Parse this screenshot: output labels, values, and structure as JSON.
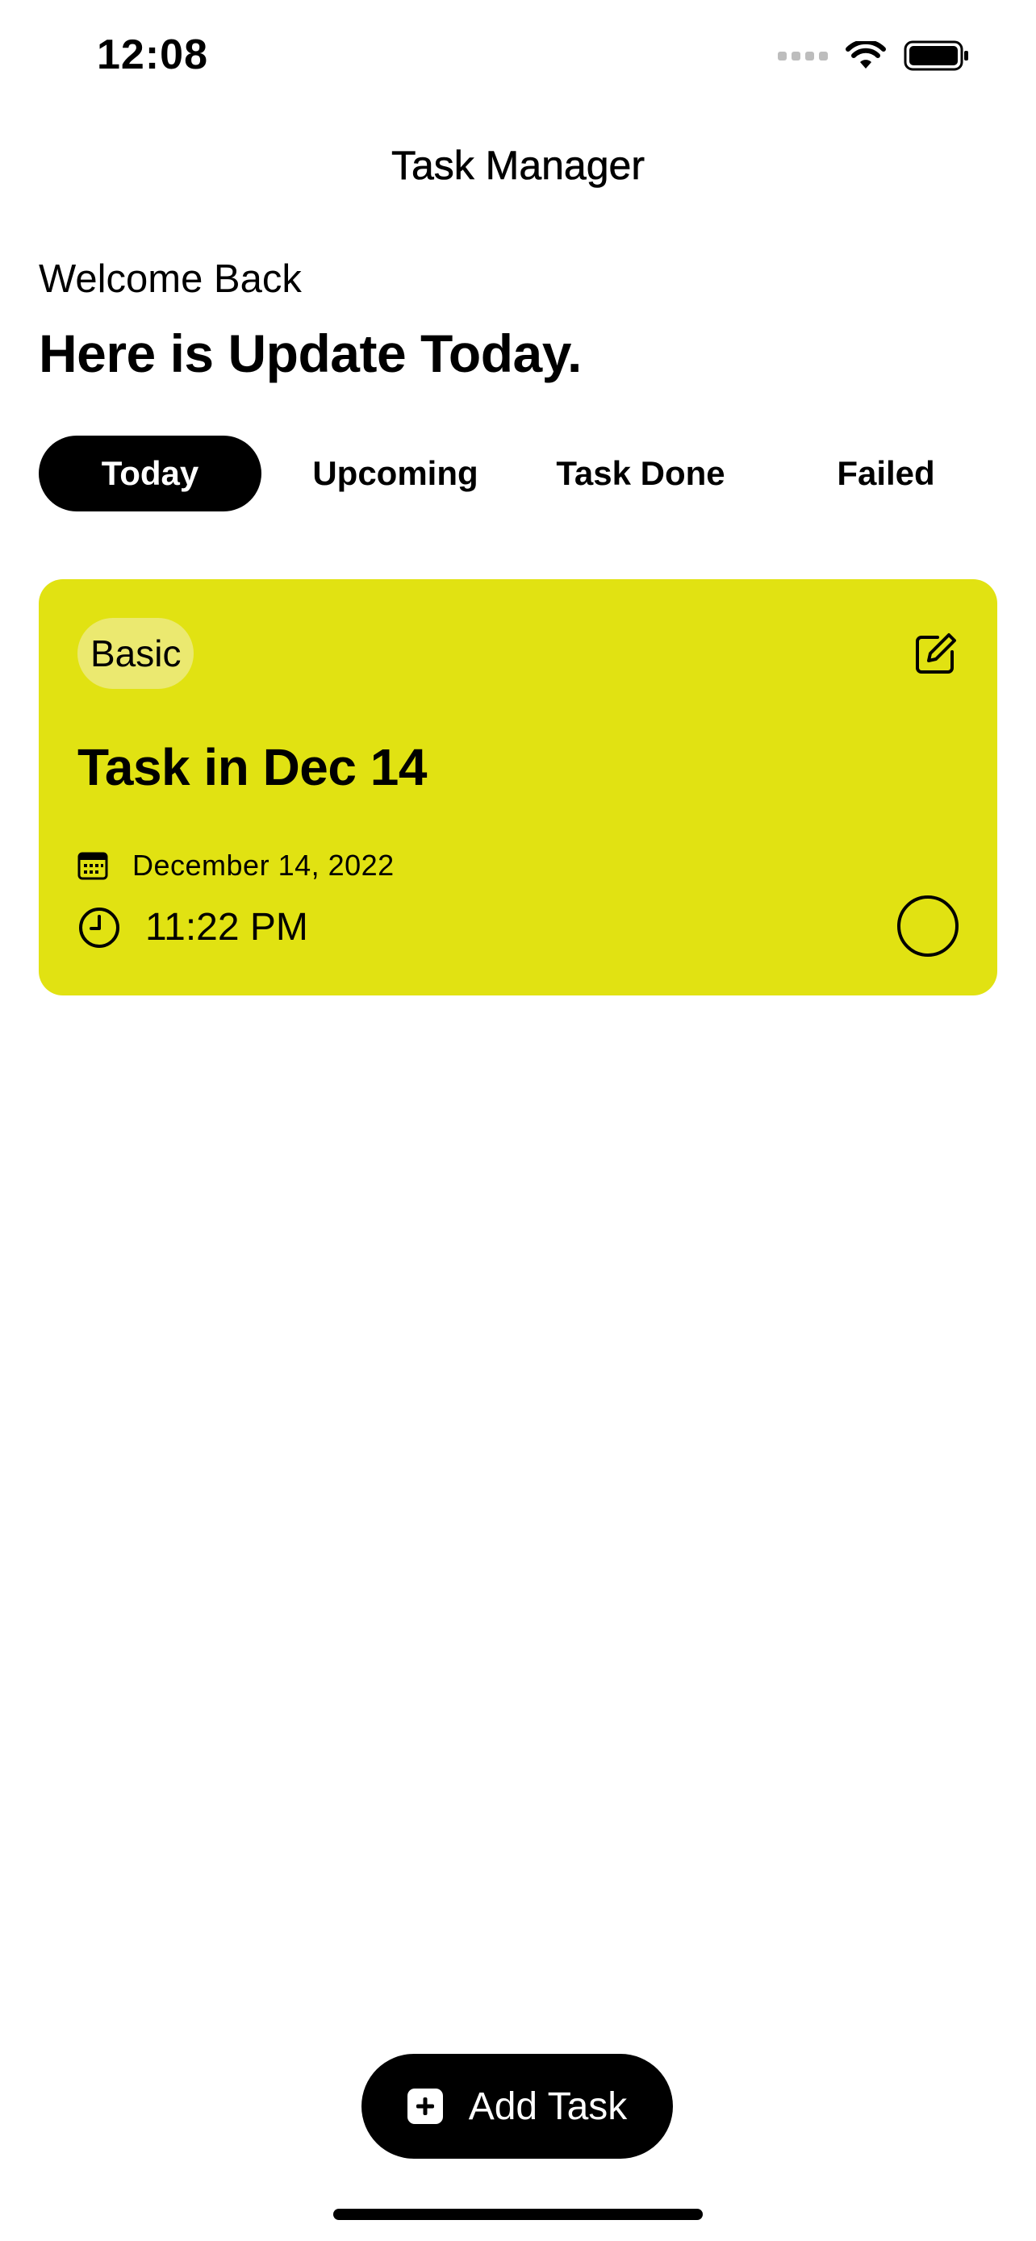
{
  "status_bar": {
    "time": "12:08",
    "icons": [
      "cellular-signal-icon",
      "wifi-icon",
      "battery-icon"
    ]
  },
  "nav": {
    "title": "Task Manager"
  },
  "greeting": {
    "welcome": "Welcome Back",
    "headline": "Here is Update Today."
  },
  "tabs": [
    {
      "label": "Today",
      "active": true
    },
    {
      "label": "Upcoming",
      "active": false
    },
    {
      "label": "Task Done",
      "active": false
    },
    {
      "label": "Failed",
      "active": false
    }
  ],
  "tasks": [
    {
      "tag": "Basic",
      "title": "Task in Dec 14",
      "date": "December 14, 2022",
      "time": "11:22 PM",
      "completed": false,
      "card_color": "#e1e212",
      "tag_color": "#ebe970",
      "icons": {
        "edit": "edit-icon",
        "date": "calendar-icon",
        "time": "clock-icon",
        "toggle": "circle-checkbox-icon"
      }
    }
  ],
  "add_button": {
    "label": "Add Task",
    "icon": "plus-square-icon"
  },
  "colors": {
    "accent": "#e1e212",
    "primary": "#000000",
    "background": "#ffffff"
  }
}
